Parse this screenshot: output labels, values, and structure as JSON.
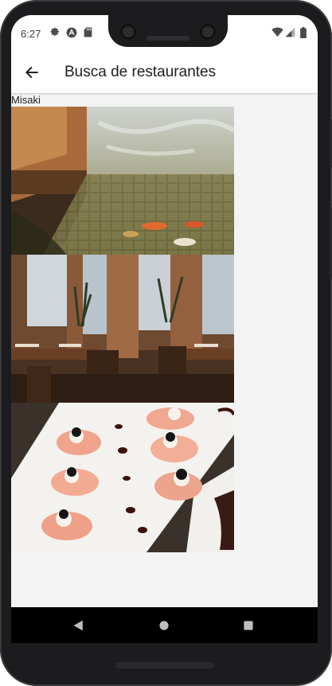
{
  "status_bar": {
    "time": "6:27",
    "left_icons": [
      "gear-icon",
      "sync-icon",
      "sd-card-icon"
    ],
    "right_icons": [
      "wifi-icon",
      "signal-icon",
      "battery-icon"
    ]
  },
  "app_bar": {
    "title": "Busca de restaurantes",
    "back_icon": "arrow-back-icon"
  },
  "restaurant": {
    "name": "Misaki",
    "photos": [
      {
        "subject": "koi pond with tiled bottom"
      },
      {
        "subject": "restaurant dining room interior"
      },
      {
        "subject": "salmon sushi rolls with caviar on white plate"
      }
    ]
  },
  "nav_bar": {
    "icons": [
      "back-triangle-icon",
      "home-circle-icon",
      "recents-square-icon"
    ]
  },
  "colors": {
    "appbar_bg": "#ffffff",
    "screen_bg": "#f3f3f3",
    "nav_bg": "#000000",
    "text_primary": "#1f1f1f"
  }
}
